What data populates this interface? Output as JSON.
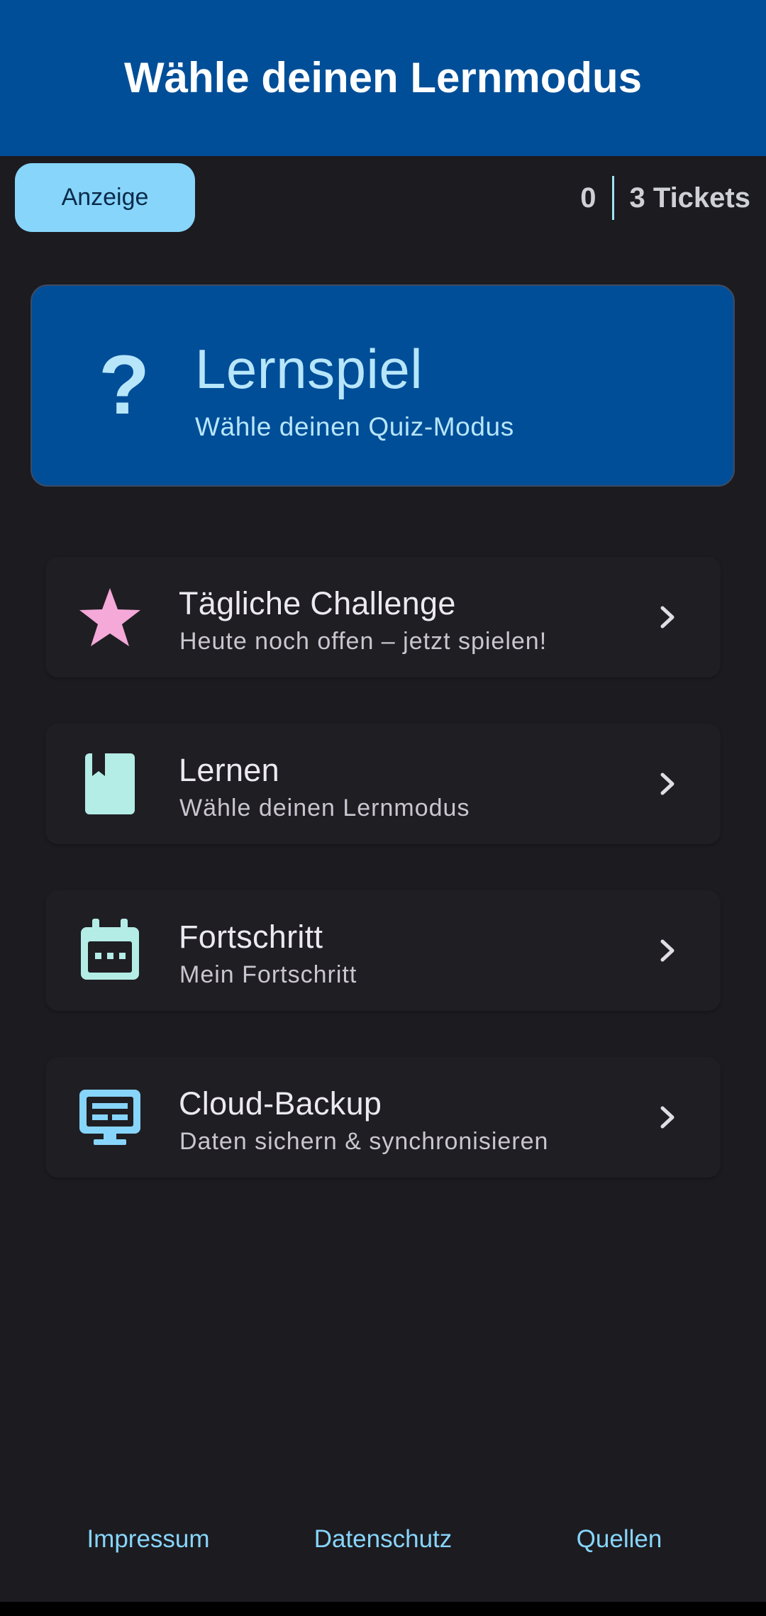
{
  "header": {
    "title": "Wähle deinen Lernmodus",
    "background": "#004e98"
  },
  "toolbar": {
    "ad_label": "Anzeige",
    "ticket_count": "0",
    "tickets_label": "3 Tickets"
  },
  "hero": {
    "icon": "question-mark-icon",
    "title": "Lernspiel",
    "subtitle": "Wähle deinen Quiz-Modus"
  },
  "menu": {
    "items": [
      {
        "icon": "star-icon",
        "icon_color": "#f4a9d8",
        "title": "Tägliche Challenge",
        "subtitle": "Heute noch offen – jetzt spielen!"
      },
      {
        "icon": "book-icon",
        "icon_color": "#b4ece6",
        "title": "Lernen",
        "subtitle": "Wähle deinen Lernmodus"
      },
      {
        "icon": "calendar-icon",
        "icon_color": "#b4ece6",
        "title": "Fortschritt",
        "subtitle": "Mein Fortschritt"
      },
      {
        "icon": "monitor-icon",
        "icon_color": "#87d5fb",
        "title": "Cloud-Backup",
        "subtitle": "Daten sichern & synchronisieren"
      }
    ]
  },
  "footer": {
    "impressum": "Impressum",
    "datenschutz": "Datenschutz",
    "quellen": "Quellen"
  },
  "colors": {
    "accent": "#87d5fb",
    "surface": "#1c1b20"
  }
}
